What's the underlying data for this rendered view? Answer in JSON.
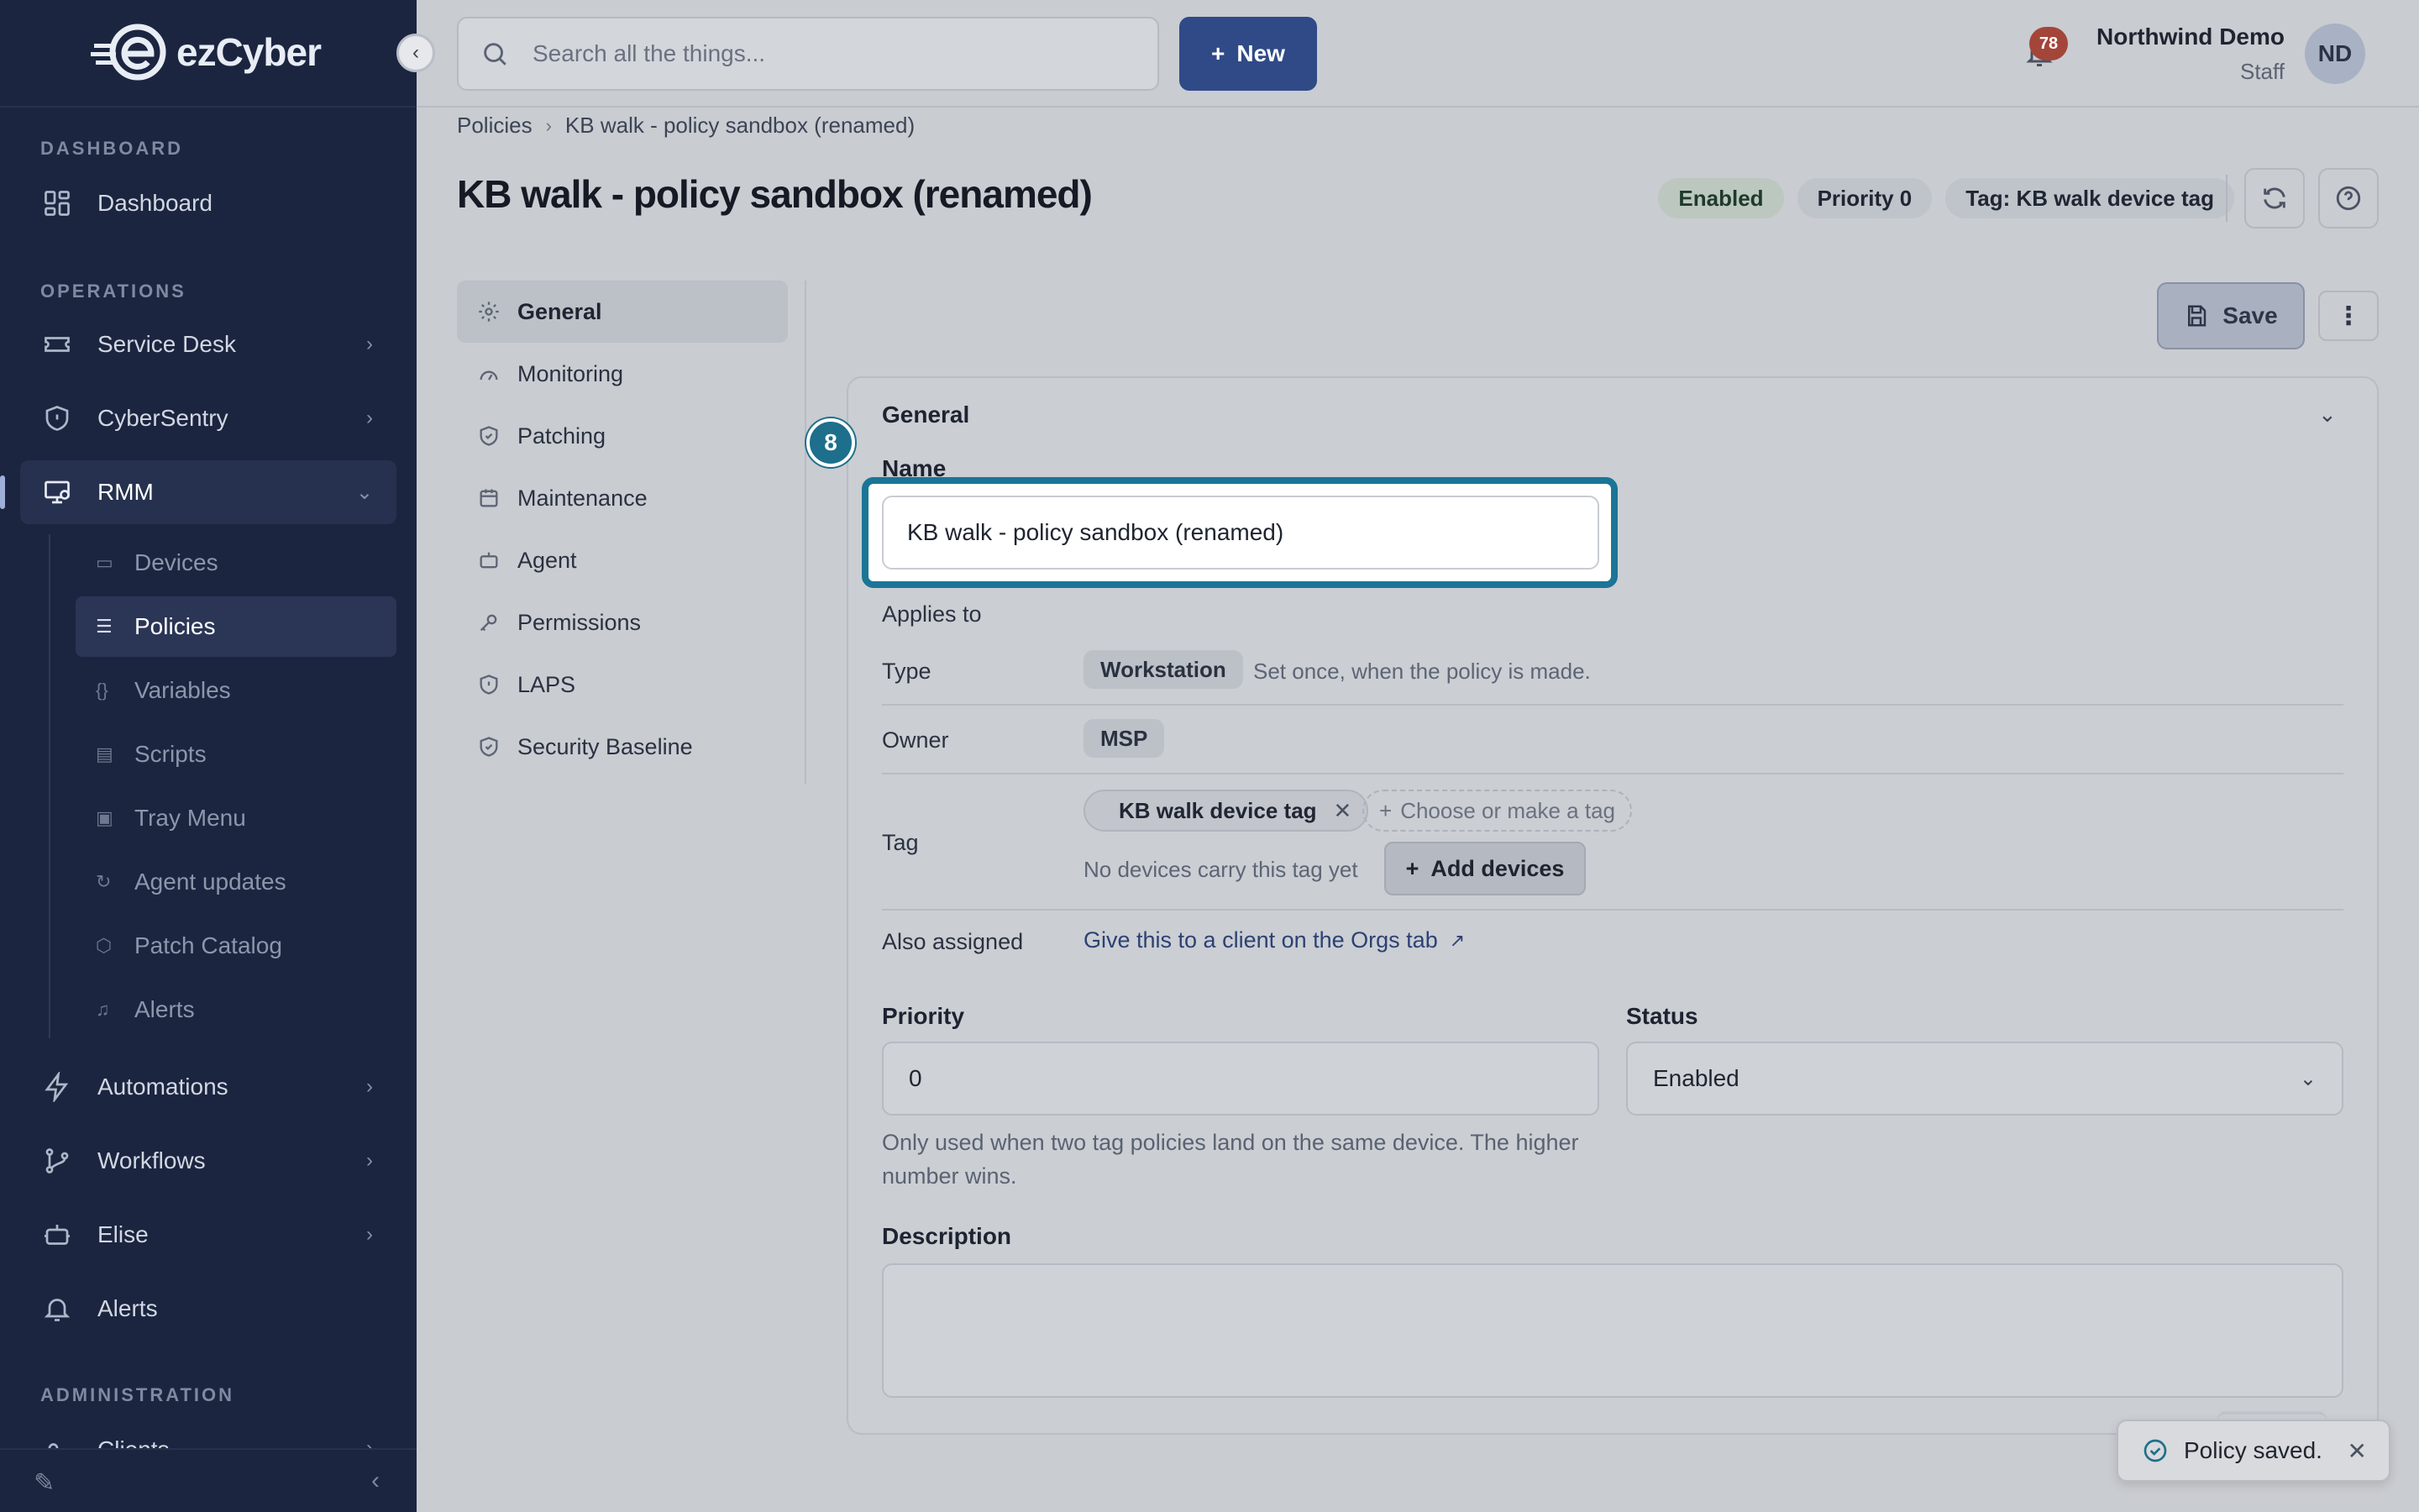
{
  "app": {
    "logo_text": "ezCyber",
    "colors": {
      "sidebar_bg": "#1b2540",
      "accent": "#2f4a87",
      "highlight": "#1b7596",
      "badge": "#a4453a"
    }
  },
  "sidebar": {
    "sections": {
      "dashboard": "DASHBOARD",
      "operations": "OPERATIONS",
      "administration": "ADMINISTRATION"
    },
    "items": {
      "dashboard": "Dashboard",
      "service_desk": "Service Desk",
      "cybersentry": "CyberSentry",
      "rmm": "RMM",
      "automations": "Automations",
      "workflows": "Workflows",
      "elise": "Elise",
      "alerts": "Alerts",
      "clients": "Clients"
    },
    "rmm_sub": {
      "devices": "Devices",
      "policies": "Policies",
      "variables": "Variables",
      "scripts": "Scripts",
      "tray_menu": "Tray Menu",
      "agent_updates": "Agent updates",
      "patch_catalog": "Patch Catalog",
      "alerts": "Alerts"
    }
  },
  "topbar": {
    "search_placeholder": "Search all the things...",
    "new_label": "New",
    "notification_count": "78",
    "user_name": "Northwind Demo",
    "user_role": "Staff",
    "avatar_initials": "ND"
  },
  "breadcrumb": {
    "parent": "Policies",
    "current": "KB walk - policy sandbox (renamed)"
  },
  "page": {
    "title": "KB walk - policy sandbox (renamed)",
    "chips": {
      "status": "Enabled",
      "priority": "Priority 0",
      "tag": "Tag: KB walk device tag"
    }
  },
  "tabs": {
    "general": "General",
    "monitoring": "Monitoring",
    "patching": "Patching",
    "maintenance": "Maintenance",
    "agent": "Agent",
    "permissions": "Permissions",
    "laps": "LAPS",
    "security_baseline": "Security Baseline"
  },
  "actions": {
    "save_label": "Save"
  },
  "panel": {
    "title": "General",
    "step_number": "8",
    "name_label": "Name",
    "name_value": "KB walk - policy sandbox (renamed)",
    "applies_to_label": "Applies to",
    "type_label": "Type",
    "type_value": "Workstation",
    "type_note": "Set once, when the policy is made.",
    "owner_label": "Owner",
    "owner_value": "MSP",
    "tag_label": "Tag",
    "tag_value": "KB walk device tag",
    "tag_add_placeholder": "Choose or make a tag",
    "tag_note": "No devices carry this tag yet",
    "add_devices_label": "Add devices",
    "also_assigned_label": "Also assigned",
    "also_assigned_link": "Give this to a client on the Orgs tab",
    "priority_label": "Priority",
    "priority_value": "0",
    "status_label": "Status",
    "status_value": "Enabled",
    "priority_help": "Only used when two tag policies land on the same device. The higher number wins.",
    "description_label": "Description",
    "description_value": ""
  },
  "toast": {
    "message": "Policy saved."
  }
}
